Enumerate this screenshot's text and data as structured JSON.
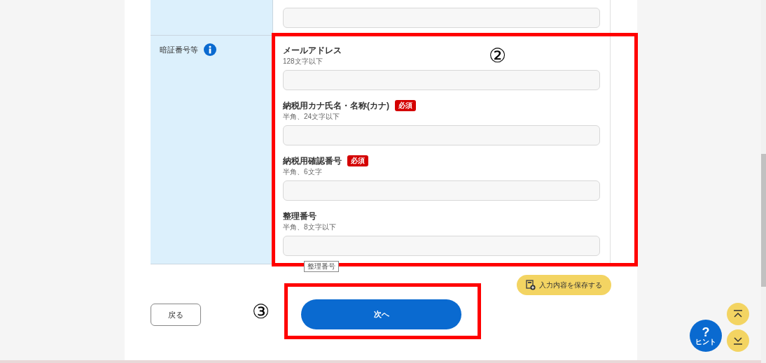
{
  "section": {
    "label": "暗証番号等",
    "fields": [
      {
        "label": "メールアドレス",
        "hint": "128文字以下",
        "required": false
      },
      {
        "label": "納税用カナ氏名・名称(カナ)",
        "hint": "半角、24文字以下",
        "required": true,
        "badge": "必須"
      },
      {
        "label": "納税用確認番号",
        "hint": "半角、6文字",
        "required": true,
        "badge": "必須"
      },
      {
        "label": "整理番号",
        "hint": "半角、8文字以下",
        "required": false,
        "tooltip": "整理番号"
      }
    ]
  },
  "annotations": [
    "②",
    "③"
  ],
  "save_button": "入力内容を保存する",
  "back_button": "戻る",
  "next_button": "次へ",
  "hint_button": {
    "symbol": "?",
    "label": "ヒント"
  }
}
